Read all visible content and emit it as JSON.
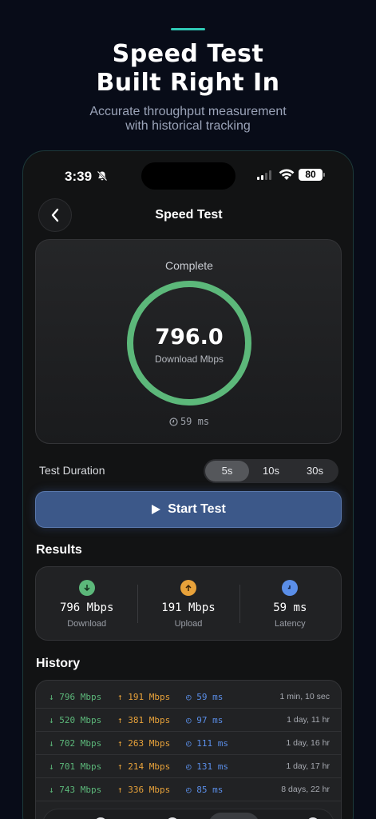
{
  "hero": {
    "title_line1": "Speed Test",
    "title_line2": "Built Right In",
    "subtitle_line1": "Accurate throughput measurement",
    "subtitle_line2": "with historical tracking"
  },
  "status_bar": {
    "time": "3:39",
    "battery": "80"
  },
  "nav": {
    "title": "Speed Test"
  },
  "gauge": {
    "status": "Complete",
    "value": "796.0",
    "label": "Download Mbps",
    "latency": "59 ms",
    "progress": 1.0
  },
  "duration": {
    "label": "Test Duration",
    "options": [
      "5s",
      "10s",
      "30s"
    ],
    "selected": "5s"
  },
  "start_button": {
    "label": "Start Test"
  },
  "results": {
    "title": "Results",
    "download": {
      "value": "796 Mbps",
      "label": "Download"
    },
    "upload": {
      "value": "191 Mbps",
      "label": "Upload"
    },
    "latency": {
      "value": "59 ms",
      "label": "Latency"
    }
  },
  "history": {
    "title": "History",
    "rows": [
      {
        "download": "796 Mbps",
        "upload": "191 Mbps",
        "latency": "59 ms",
        "ago": "1 min, 10 sec"
      },
      {
        "download": "520 Mbps",
        "upload": "381 Mbps",
        "latency": "97 ms",
        "ago": "1 day, 11 hr"
      },
      {
        "download": "702 Mbps",
        "upload": "263 Mbps",
        "latency": "111 ms",
        "ago": "1 day, 16 hr"
      },
      {
        "download": "701 Mbps",
        "upload": "214 Mbps",
        "latency": "131 ms",
        "ago": "1 day, 17 hr"
      },
      {
        "download": "743 Mbps",
        "upload": "336 Mbps",
        "latency": "85 ms",
        "ago": "8 days, 22 hr"
      }
    ]
  },
  "colors": {
    "accent": "#2fc9b5",
    "download": "#5cb87a",
    "upload": "#e8a23a",
    "latency": "#5a8ee8",
    "button": "#3c5889"
  }
}
